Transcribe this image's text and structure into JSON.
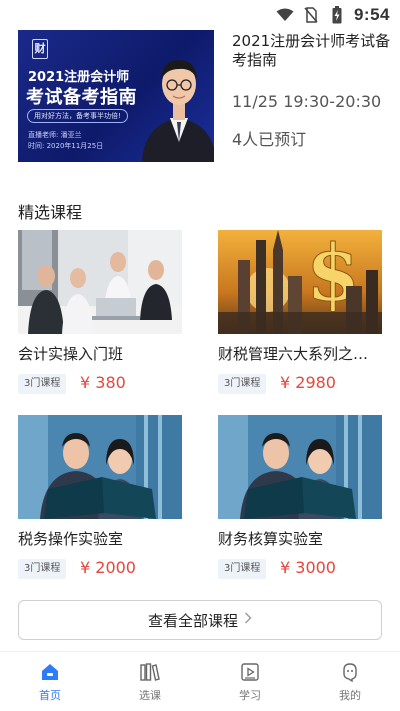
{
  "status_bar": {
    "time": "9:54",
    "icons": [
      "wifi-icon",
      "no-sim-icon",
      "battery-charging-icon"
    ]
  },
  "live": {
    "poster": {
      "line1": "2021注册会计师",
      "line2": "考试备考指南",
      "tag": "用对好方法，备考事半功倍!",
      "teacher": "直播老师: 潘亚兰",
      "time": "时间: 2020年11月25日"
    },
    "title": "2021注册会计师考试备考指南",
    "time": "11/25 19:30-20:30",
    "reservations": "4人已预订"
  },
  "section_title": "精选课程",
  "courses": [
    {
      "name": "会计实操入门班",
      "badge": "3门课程",
      "price": "¥ 380",
      "image": "office-team-photo"
    },
    {
      "name": "财税管理六大系列之…",
      "badge": "3门课程",
      "price": "¥ 2980",
      "image": "dollar-city-photo"
    },
    {
      "name": "税务操作实验室",
      "badge": "3门课程",
      "price": "¥ 2000",
      "image": "business-couple-photo"
    },
    {
      "name": "财务核算实验室",
      "badge": "3门课程",
      "price": "¥ 3000",
      "image": "business-couple-photo"
    }
  ],
  "view_all": {
    "label": "查看全部课程",
    "icon": "chevron-right-icon"
  },
  "tabs": [
    {
      "label": "首页",
      "icon": "home-icon",
      "active": true
    },
    {
      "label": "选课",
      "icon": "books-icon",
      "active": false
    },
    {
      "label": "学习",
      "icon": "video-play-icon",
      "active": false
    },
    {
      "label": "我的",
      "icon": "profile-icon",
      "active": false
    }
  ],
  "colors": {
    "accent": "#2e7cf6",
    "price": "#e6473c",
    "poster_bg": "#1a2a8a",
    "badge_bg": "#eef3fa"
  }
}
